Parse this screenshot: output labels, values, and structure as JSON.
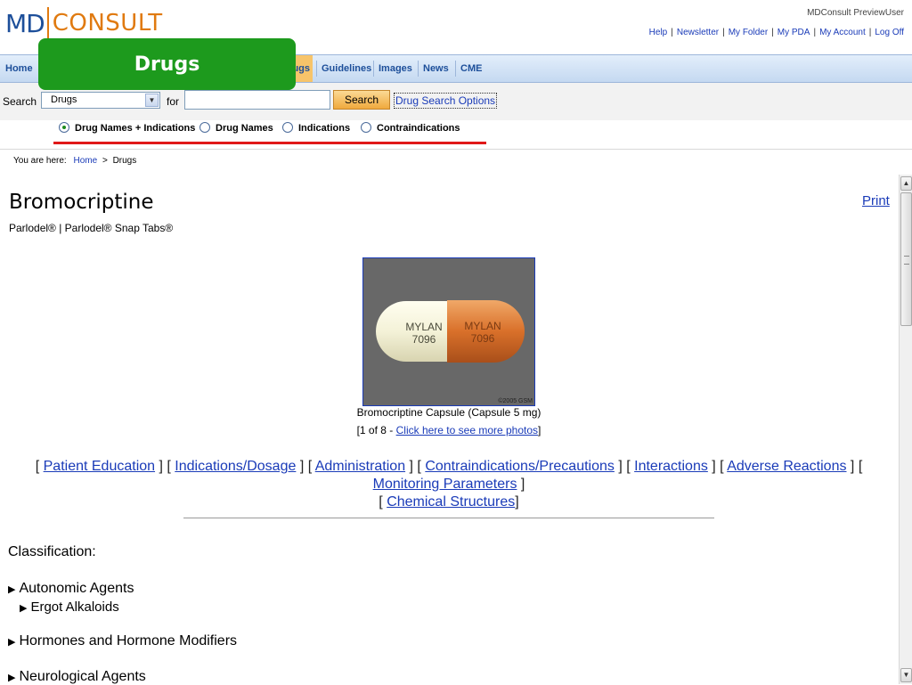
{
  "header": {
    "logo_md": "MD",
    "logo_consult": "CONSULT",
    "user": "MDConsult PreviewUser",
    "links": [
      "Help",
      "Newsletter",
      "My Folder",
      "My PDA",
      "My Account",
      "Log Off"
    ]
  },
  "nav": {
    "items": [
      {
        "label": "Home"
      },
      {
        "label": "ugs"
      },
      {
        "label": "Guidelines"
      },
      {
        "label": "Images"
      },
      {
        "label": "News"
      },
      {
        "label": "CME"
      }
    ]
  },
  "overlay": {
    "label": "Drugs"
  },
  "search": {
    "label": "Search",
    "select_value": "Drugs",
    "for_label": "for",
    "input_value": "",
    "button": "Search",
    "options_link": "Drug Search Options",
    "radios": [
      {
        "label": "Drug Names + Indications",
        "checked": true
      },
      {
        "label": "Drug Names",
        "checked": false
      },
      {
        "label": "Indications",
        "checked": false
      },
      {
        "label": "Contraindications",
        "checked": false
      }
    ]
  },
  "breadcrumb": {
    "prefix": "You are here:",
    "home": "Home",
    "sep": ">",
    "current": "Drugs"
  },
  "drug": {
    "name": "Bromocriptine",
    "brands": "Parlodel® | Parlodel® Snap Tabs®",
    "print": "Print",
    "image": {
      "imprint_line1": "MYLAN",
      "imprint_line2": "7096",
      "copyright": "©2005 GSM",
      "caption": "Bromocriptine Capsule (Capsule 5 mg)",
      "count_text": "[1 of 8 - ",
      "more_link": "Click here to see more photos",
      "count_end": "]"
    }
  },
  "sections": [
    "Patient Education",
    "Indications/Dosage",
    "Administration",
    "Contraindications/Precautions",
    "Interactions",
    "Adverse Reactions",
    "Monitoring Parameters",
    "Chemical Structures"
  ],
  "classification": {
    "heading": "Classification:",
    "items": [
      {
        "label": "Autonomic Agents",
        "sub": "Ergot Alkaloids"
      },
      {
        "label": "Hormones and Hormone Modifiers"
      },
      {
        "label": "Neurological Agents"
      }
    ]
  },
  "colors": {
    "brand_blue": "#1d4f9a",
    "brand_orange": "#e07a10",
    "overlay_green": "#1d9a1d",
    "active_tab": "#f7c46a",
    "link": "#1a3bb8",
    "underline_red": "#e01818"
  }
}
